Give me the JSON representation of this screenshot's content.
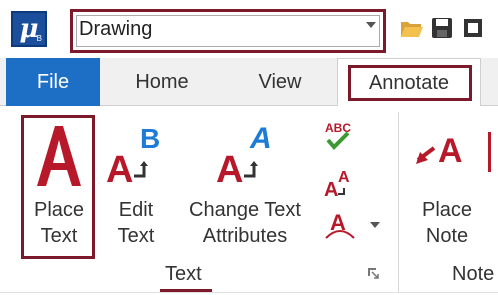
{
  "titlebar": {
    "logo_letter": "μ",
    "logo_sub": "B",
    "workflow_value": "Drawing"
  },
  "tabs": {
    "file": "File",
    "home": "Home",
    "view": "View",
    "annotate": "Annotate"
  },
  "ribbon": {
    "text_group": {
      "label": "Text",
      "buttons": {
        "place_text": [
          "Place",
          "Text"
        ],
        "edit_text": [
          "Edit",
          "Text"
        ],
        "change_attrs": [
          "Change Text",
          "Attributes"
        ]
      },
      "small_icons": {
        "spell_check_text": "ABC"
      }
    },
    "notes_group": {
      "label": "Note",
      "place_note": [
        "Place",
        "Note"
      ]
    }
  },
  "colors": {
    "accent_red": "#b8192a",
    "highlight": "#7c1a2b",
    "file_tab": "#1d6fc5",
    "icon_blue": "#1e7bd6",
    "check_green": "#3a9a2f"
  },
  "icons": {
    "logo": "microstation-logo",
    "open": "folder-open-icon",
    "save": "save-icon",
    "spell": "spell-check-icon"
  }
}
